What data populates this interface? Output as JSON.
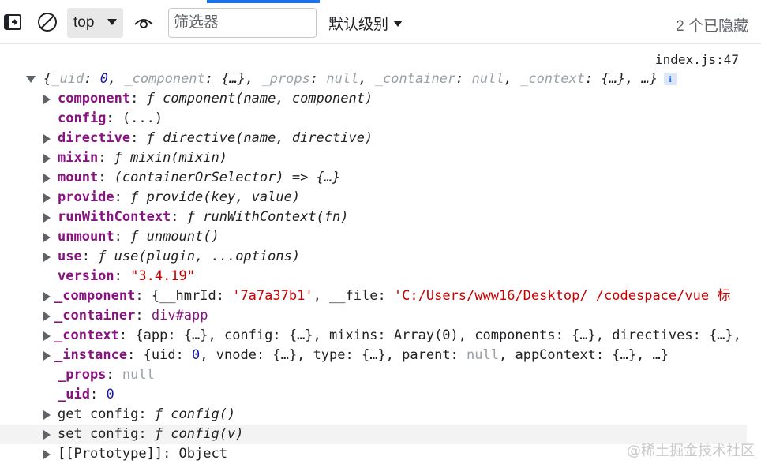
{
  "toolbar": {
    "context": "top",
    "filter_placeholder": "筛选器",
    "levels_label": "默认级别",
    "hidden_count": "2 个已隐藏",
    "icons": [
      "sidebar-toggle-icon",
      "clear-console-icon",
      "live-expression-eye-icon"
    ]
  },
  "console": {
    "source_link": "index.js:47",
    "summary": {
      "open": "{",
      "parts": [
        {
          "key": "_uid",
          "value": "0"
        },
        {
          "key": "_component",
          "value": "{…}"
        },
        {
          "key": "_props",
          "value": "null"
        },
        {
          "key": "_container",
          "value": "null"
        },
        {
          "key": "_context",
          "value": "{…}"
        }
      ],
      "tail": ", …}",
      "info_badge": "i"
    },
    "lines": [
      {
        "key": "component",
        "sep": ": ",
        "value": "ƒ component(name, component)"
      },
      {
        "key": "config",
        "sep": ": ",
        "value": "(...)"
      },
      {
        "key": "directive",
        "sep": ": ",
        "value": "ƒ directive(name, directive)"
      },
      {
        "key": "mixin",
        "sep": ": ",
        "value": "ƒ mixin(mixin)"
      },
      {
        "key": "mount",
        "sep": ": ",
        "value": "(containerOrSelector) => {…}"
      },
      {
        "key": "provide",
        "sep": ": ",
        "value": "ƒ provide(key, value)"
      },
      {
        "key": "runWithContext",
        "sep": ": ",
        "value": "ƒ runWithContext(fn)"
      },
      {
        "key": "unmount",
        "sep": ": ",
        "value": "ƒ unmount()"
      },
      {
        "key": "use",
        "sep": ": ",
        "value": "ƒ use(plugin, ...options)"
      },
      {
        "key": "version",
        "sep": ": ",
        "value": "\"3.4.19\""
      },
      {
        "key": "_component",
        "sep": ": ",
        "v1": "{__hmrId: ",
        "v2": "'7a7a37b1'",
        "v3": ", __file: ",
        "v4": "'C:/Users/www16/Desktop/    /codespace/vue 标"
      },
      {
        "key": "_container",
        "sep": ": ",
        "value": "div#app"
      },
      {
        "key": "_context",
        "sep": ": ",
        "value": "{app: {…}, config: {…}, mixins: Array(0), components: {…}, directives: {…},"
      },
      {
        "key": "_instance",
        "sep": ": ",
        "v1": "{uid: ",
        "v2": "0",
        "v3": ", vnode: {…}, type: {…}, parent: ",
        "v4": "null",
        "v5": ", appContext: {…}, …}"
      },
      {
        "key": "_props",
        "sep": ": ",
        "value": "null"
      },
      {
        "key": "_uid",
        "sep": ": ",
        "value": "0"
      },
      {
        "key": "get config",
        "sep": ": ",
        "value": "ƒ config()"
      },
      {
        "key": "set config",
        "sep": ": ",
        "value": "ƒ config(v)"
      },
      {
        "key": "[[Prototype]]",
        "sep": ": ",
        "value": "Object"
      }
    ]
  },
  "watermark": "@稀土掘金技术社区"
}
